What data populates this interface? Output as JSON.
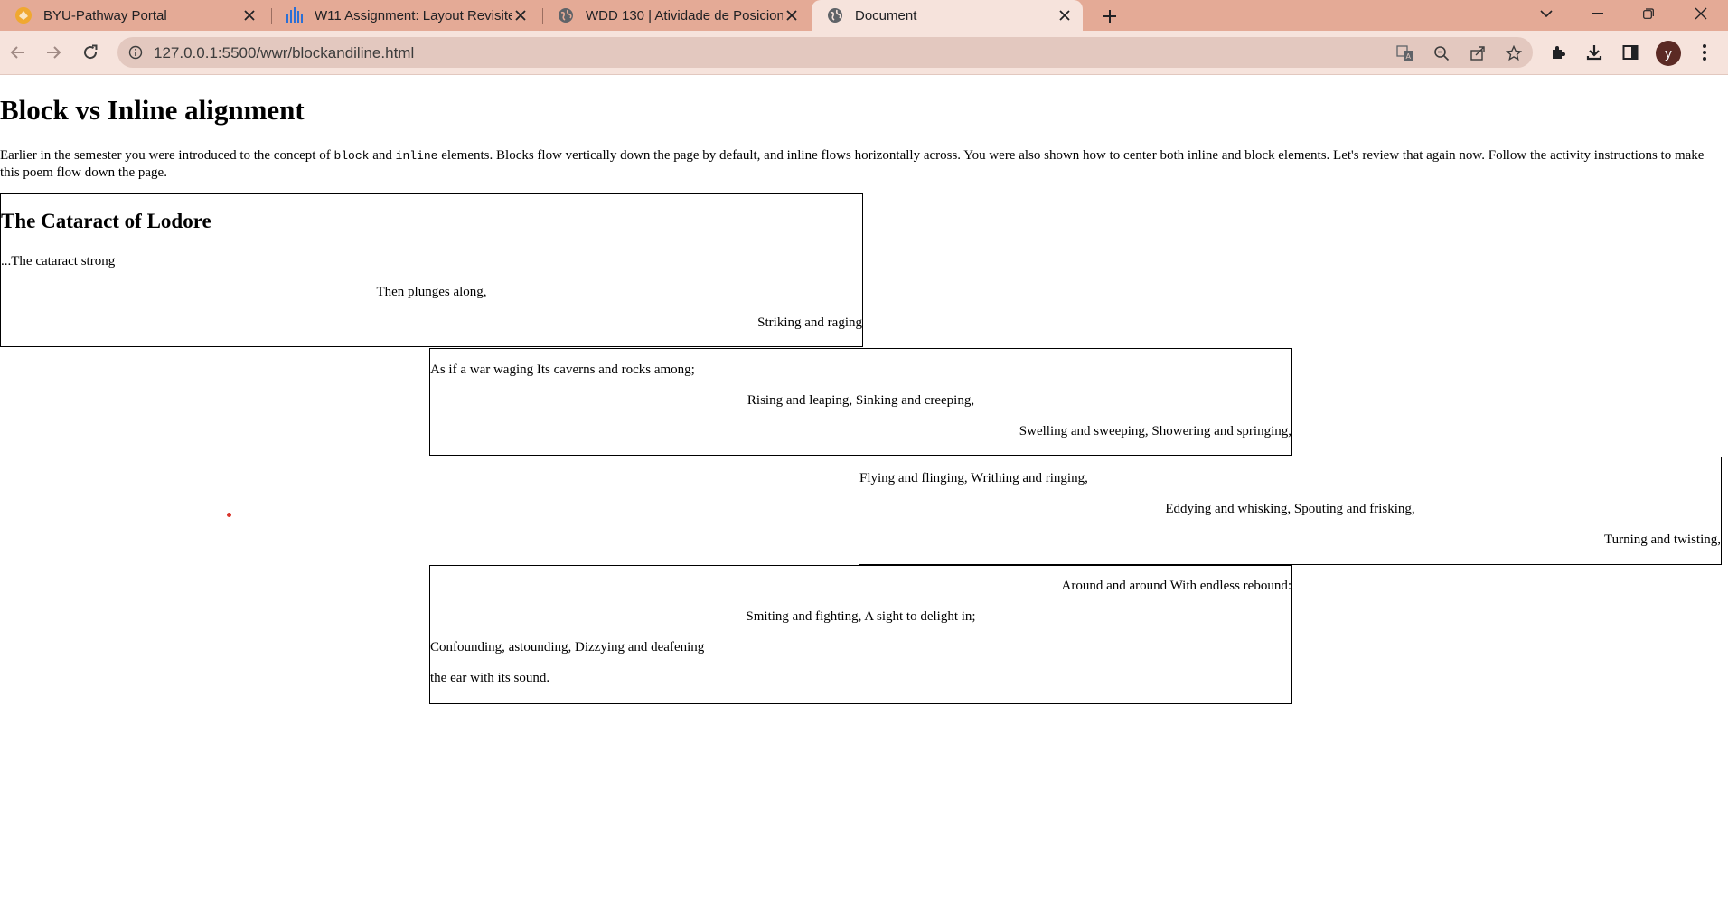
{
  "browser": {
    "tabs": [
      {
        "title": "BYU-Pathway Portal",
        "icon": "byu-pathway-favicon"
      },
      {
        "title": "W11 Assignment: Layout Revisite",
        "icon": "canvas-favicon"
      },
      {
        "title": "WDD 130 | Atividade de Posicion",
        "icon": "globe-icon"
      },
      {
        "title": "Document",
        "icon": "globe-icon"
      }
    ],
    "url": "127.0.0.1:5500/wwr/blockandiline.html",
    "profile_initial": "y"
  },
  "page": {
    "title": "Block vs Inline alignment",
    "intro_before_block": "Earlier in the semester you were introduced to the concept of ",
    "code_block": "block",
    "intro_and": " and ",
    "code_inline": "inline",
    "intro_after_inline": " elements. Blocks flow vertically down the page by default, and inline flows horizontally across. You were also shown how to center both inline and block elements. Let's review that again now. Follow the activity instructions to make this poem flow down the page.",
    "poem": {
      "title": "The Cataract of Lodore",
      "box1": [
        "...The cataract strong",
        "Then plunges along,",
        "Striking and raging"
      ],
      "box2": [
        "As if a war waging Its caverns and rocks among;",
        "Rising and leaping, Sinking and creeping,",
        "Swelling and sweeping, Showering and springing,"
      ],
      "box3": [
        "Flying and flinging, Writhing and ringing,",
        "Eddying and whisking, Spouting and frisking,",
        "Turning and twisting,"
      ],
      "box4": [
        "Around and around With endless rebound:",
        "Smiting and fighting, A sight to delight in;",
        "Confounding, astounding, Dizzying and deafening",
        "the ear with its sound."
      ]
    }
  },
  "colors": {
    "tabstrip": "#e4aa96",
    "toolbar": "#f6e3dc",
    "omnibox": "#e3c8bf"
  }
}
